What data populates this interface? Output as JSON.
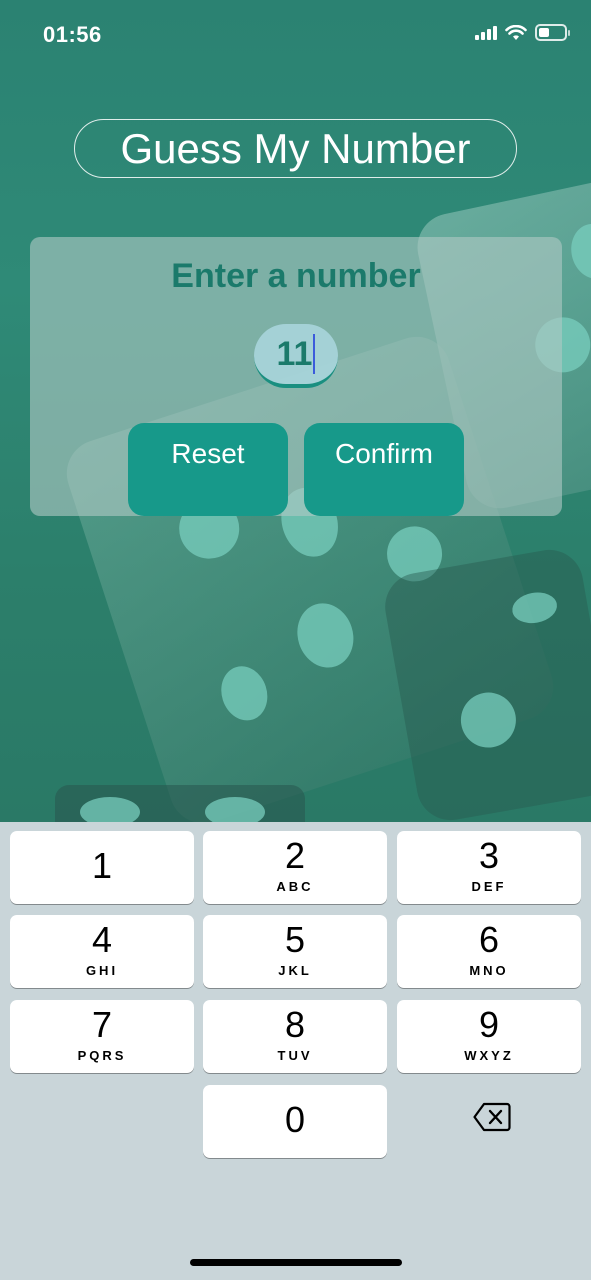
{
  "status_bar": {
    "time": "01:56",
    "battery_level": 0.4
  },
  "app": {
    "title": "Guess My Number",
    "prompt": "Enter a number",
    "input_value": "11",
    "reset_label": "Reset",
    "confirm_label": "Confirm"
  },
  "colors": {
    "accent": "#17998a",
    "heading": "#1b7a6b",
    "background": "#2a7f70"
  },
  "keyboard": {
    "keys": [
      {
        "digit": "1",
        "letters": ""
      },
      {
        "digit": "2",
        "letters": "ABC"
      },
      {
        "digit": "3",
        "letters": "DEF"
      },
      {
        "digit": "4",
        "letters": "GHI"
      },
      {
        "digit": "5",
        "letters": "JKL"
      },
      {
        "digit": "6",
        "letters": "MNO"
      },
      {
        "digit": "7",
        "letters": "PQRS"
      },
      {
        "digit": "8",
        "letters": "TUV"
      },
      {
        "digit": "9",
        "letters": "WXYZ"
      },
      {
        "digit": "0",
        "letters": ""
      }
    ],
    "delete_icon": "backspace-icon"
  }
}
